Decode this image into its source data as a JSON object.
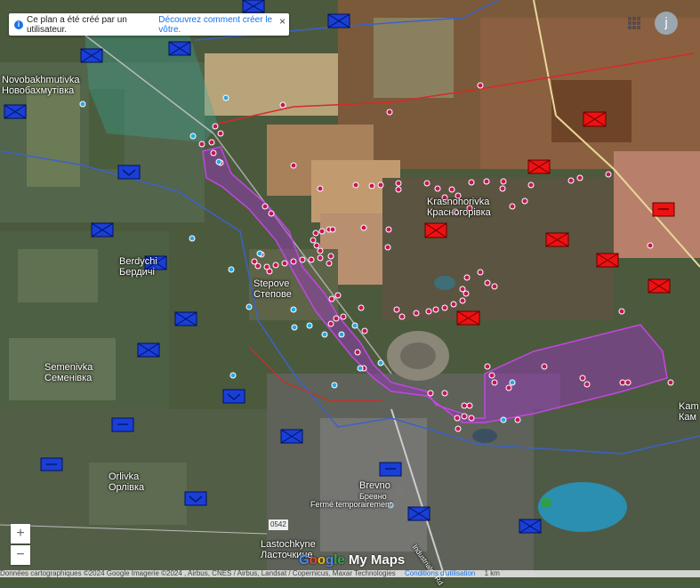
{
  "banner": {
    "text": "Ce plan a été créé par un utilisateur.",
    "link": "Découvrez comment créer le vôtre."
  },
  "account": {
    "initial": "j"
  },
  "zoom": {
    "in": "+",
    "out": "−"
  },
  "logo": {
    "g1": "G",
    "g2": "o",
    "g3": "o",
    "g4": "g",
    "g5": "le",
    "mymaps": " My Maps"
  },
  "footer": {
    "attribution": "Données cartographiques ©2024 Google Imagerie ©2024 , Airbus, CNES / Airbus, Landsat / Copernicus, Maxar Technologies",
    "terms": "Conditions d'utilisation",
    "scale": "1 km"
  },
  "places": [
    {
      "latin": "Novobakhmutivka",
      "cyrillic": "Новобахмутівка"
    },
    {
      "latin": "Berdychi",
      "cyrillic": "Бердичі"
    },
    {
      "latin": "Stepove",
      "cyrillic": "Степове"
    },
    {
      "latin": "Semenivka",
      "cyrillic": "Семенівка"
    },
    {
      "latin": "Orlivka",
      "cyrillic": "Орлівка"
    },
    {
      "latin": "Krasnohorivka",
      "cyrillic": "Красногорівка"
    },
    {
      "latin": "Brevno",
      "cyrillic": "Бревно"
    },
    {
      "latin": "Fermé temporairement",
      "cyrillic": ""
    },
    {
      "latin": "Lastochkyne",
      "cyrillic": "Ласточкине"
    },
    {
      "latin": "Kam",
      "cyrillic": "Кам"
    },
    {
      "latin": "0542",
      "cyrillic": ""
    },
    {
      "latin": "Industrialny Rd",
      "cyrillic": ""
    }
  ],
  "colors": {
    "ua_unit": "#1a3fd6",
    "ru_unit": "#ee1111",
    "zone_fill": "#a034c8",
    "dot_ru": "#c2185b",
    "dot_ua": "#29a8e0"
  }
}
